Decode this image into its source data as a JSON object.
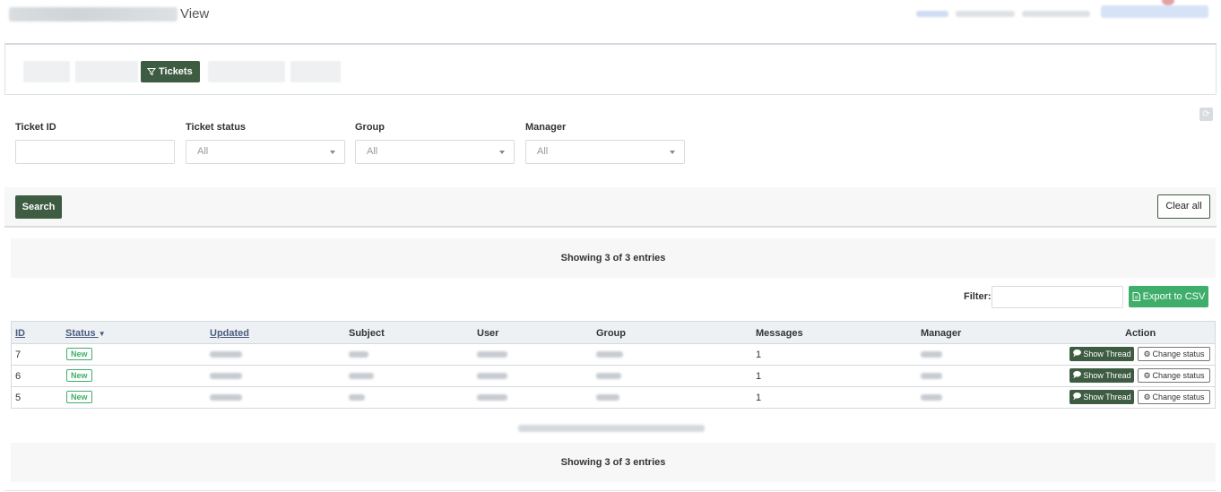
{
  "header": {
    "title_suffix": "View"
  },
  "tabs": {
    "active_label": "Tickets"
  },
  "filters": {
    "ticket_id": {
      "label": "Ticket ID",
      "value": ""
    },
    "ticket_status": {
      "label": "Ticket status",
      "value": "All"
    },
    "group": {
      "label": "Group",
      "value": "All"
    },
    "manager": {
      "label": "Manager",
      "value": "All"
    }
  },
  "actions": {
    "search_label": "Search",
    "clear_label": "Clear all"
  },
  "table": {
    "entries_text": "Showing 3 of 3 entries",
    "filter_label": "Filter:",
    "filter_value": "",
    "export_label": "Export to CSV",
    "columns": {
      "id": "ID",
      "status": "Status",
      "updated": "Updated",
      "subject": "Subject",
      "user": "User",
      "group": "Group",
      "messages": "Messages",
      "manager": "Manager",
      "action": "Action"
    },
    "rows": [
      {
        "id": "7",
        "status": "New",
        "messages": "1",
        "show_thread": "Show Thread",
        "change_status": "Change status"
      },
      {
        "id": "6",
        "status": "New",
        "messages": "1",
        "show_thread": "Show Thread",
        "change_status": "Change status"
      },
      {
        "id": "5",
        "status": "New",
        "messages": "1",
        "show_thread": "Show Thread",
        "change_status": "Change status"
      }
    ]
  },
  "colors": {
    "primary": "#3d5c41",
    "export": "#3fae6a",
    "badge": "#3fae6a"
  }
}
